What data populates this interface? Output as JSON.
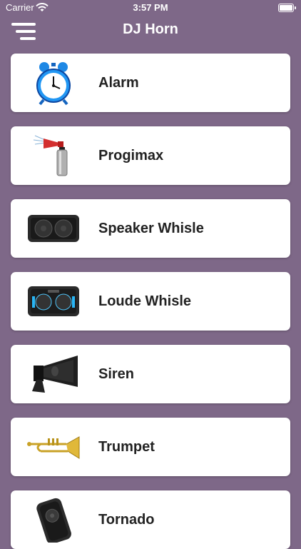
{
  "status_bar": {
    "carrier": "Carrier",
    "time": "3:57 PM"
  },
  "nav": {
    "title": "DJ Horn",
    "menu_icon": "hamburger-menu-icon"
  },
  "sounds": [
    {
      "label": "Alarm",
      "icon": "alarm-clock-icon"
    },
    {
      "label": "Progimax",
      "icon": "air-horn-icon"
    },
    {
      "label": "Speaker Whisle",
      "icon": "speaker-icon"
    },
    {
      "label": "Loude Whisle",
      "icon": "loud-speaker-icon"
    },
    {
      "label": "Siren",
      "icon": "siren-horn-icon"
    },
    {
      "label": "Trumpet",
      "icon": "trumpet-icon"
    },
    {
      "label": "Tornado",
      "icon": "tornado-speaker-icon"
    }
  ],
  "colors": {
    "background": "#7e6888",
    "card": "#ffffff"
  }
}
